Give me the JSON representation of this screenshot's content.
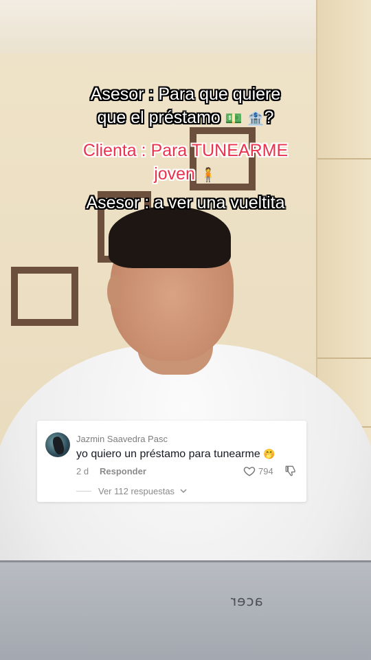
{
  "captions": {
    "line1": "Asesor : Para que quiere",
    "line2_text": "que el préstamo",
    "line2_suffix": "?",
    "line3": "Clienta : Para TUNEARME",
    "line4": "joven",
    "line5": "Asesor : a ver una vueltita"
  },
  "emojis": {
    "money_bag": "💵",
    "bank": "🏦",
    "person": "🧍"
  },
  "comment": {
    "username": "Jazmin Saavedra Pasc",
    "text": "yo quiero un préstamo para tunearme",
    "emoji": "🤭",
    "age": "2 d",
    "reply_label": "Responder",
    "like_count": "794",
    "view_replies_label": "Ver 112 respuestas"
  },
  "laptop": {
    "brand": "acer"
  },
  "colors": {
    "caption_white": "#ffffff",
    "caption_pink": "#e8344e",
    "card_bg": "#ffffff",
    "text_primary": "#161823",
    "text_secondary": "#8a8a8a"
  }
}
